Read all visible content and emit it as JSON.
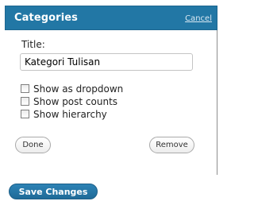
{
  "widget": {
    "title": "Categories",
    "cancel_label": "Cancel",
    "title_field_label": "Title:",
    "title_field_value": "Kategori Tulisan",
    "options": [
      {
        "label": "Show as dropdown",
        "checked": false
      },
      {
        "label": "Show post counts",
        "checked": false
      },
      {
        "label": "Show hierarchy",
        "checked": false
      }
    ],
    "done_label": "Done",
    "remove_label": "Remove"
  },
  "save_changes_label": "Save Changes",
  "colors": {
    "header_bg": "#2277a5",
    "save_button_bg": "#2277a5"
  }
}
